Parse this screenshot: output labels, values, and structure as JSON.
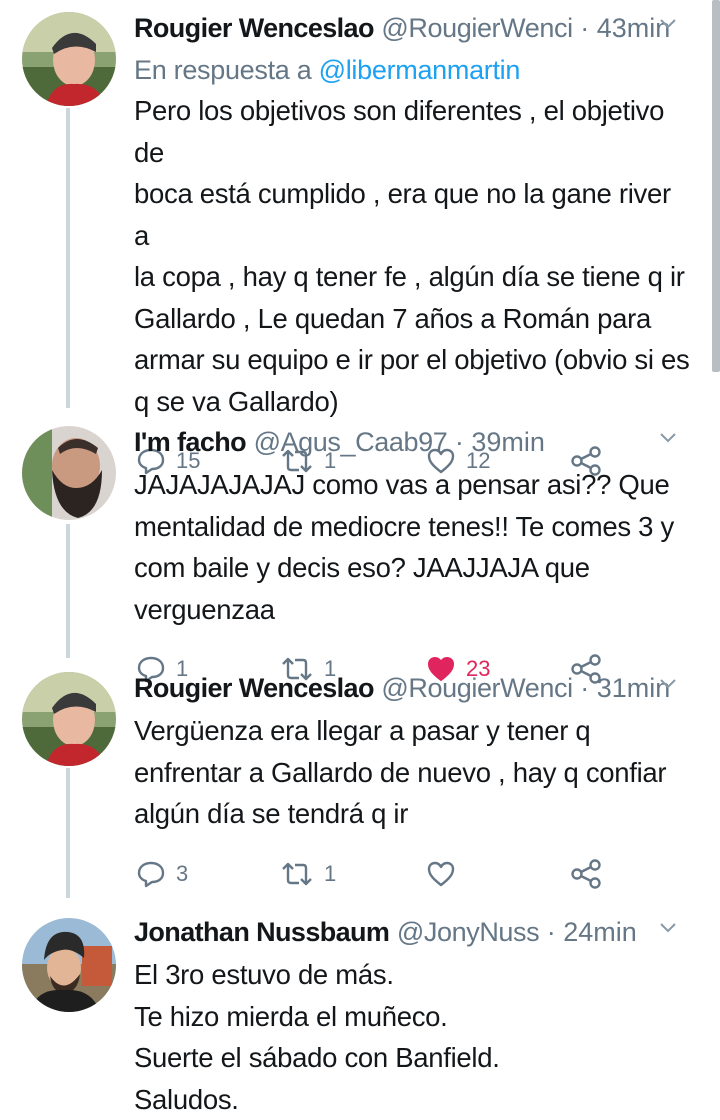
{
  "tweets": [
    {
      "name": "Rougier Wenceslao",
      "handle": "@RougierWenci",
      "time": "43min",
      "reply_prefix": "En respuesta a",
      "reply_to": "@libermanmartin",
      "lines": [
        "Pero los objetivos son diferentes , el objetivo de",
        "boca está cumplido , era que no la gane river a",
        "la copa , hay q tener fe , algún día se tiene q ir",
        "Gallardo , Le quedan 7 años a Román para",
        "armar su equipo e ir por el objetivo (obvio si es",
        "q se va Gallardo)"
      ],
      "replies": "15",
      "retweets": "1",
      "likes": "12",
      "liked": false
    },
    {
      "name": "I'm facho",
      "handle": "@Agus_Caab97",
      "time": "39min",
      "lines": [
        "JAJAJAJAJAJ como vas a pensar asi?? Que",
        "mentalidad de mediocre tenes!! Te comes 3 y",
        "com baile y decis eso? JAAJJAJA que verguenzaa"
      ],
      "replies": "1",
      "retweets": "1",
      "likes": "23",
      "liked": true
    },
    {
      "name": "Rougier Wenceslao",
      "handle": "@RougierWenci",
      "time": "31min",
      "lines": [
        "Vergüenza era llegar a pasar y tener q",
        "enfrentar a Gallardo de nuevo , hay q confiar",
        "algún día se tendrá q ir"
      ],
      "replies": "3",
      "retweets": "1",
      "likes": "",
      "liked": false
    },
    {
      "name": "Jonathan Nussbaum",
      "handle": "@JonyNuss",
      "time": "24min",
      "lines": [
        "El 3ro estuvo de más.",
        "Te hizo mierda el muñeco.",
        "Suerte el sábado con Banfield.",
        "Saludos."
      ]
    }
  ],
  "separator": "·",
  "icons": {
    "reply": "reply-icon",
    "retweet": "retweet-icon",
    "like": "heart-icon",
    "share": "share-icon",
    "menu": "chevron-down-icon"
  },
  "colors": {
    "text": "#14171a",
    "secondary": "#657786",
    "link": "#1da1f2",
    "like": "#e0245e",
    "thread_line": "#ccd6dd"
  }
}
